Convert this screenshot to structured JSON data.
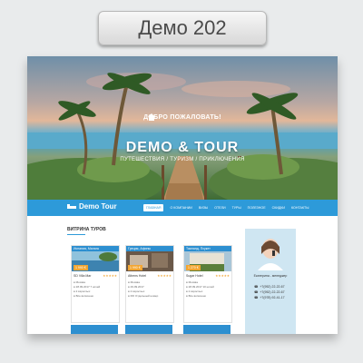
{
  "badge": {
    "label": "Демо 202"
  },
  "hero": {
    "welcome": "ДОБРО ПОЖАЛОВАТЬ!",
    "brand": "DEMO & TOUR",
    "tagline": "ПУТЕШЕСТВИЯ / ТУРИЗМ / ПРИКЛЮЧЕНИЯ"
  },
  "nav": {
    "logo": "Demo Tour",
    "items": [
      "ГЛАВНАЯ",
      "О КОМПАНИИ",
      "ВИЗЫ",
      "ОТЕЛИ",
      "ТУРЫ",
      "ПОЛЕЗНОЕ",
      "СКИДКИ",
      "КОНТАКТЫ"
    ]
  },
  "section": {
    "title": "ВИТРИНА ТУРОВ"
  },
  "cards": [
    {
      "title": "Испания, Малага",
      "price": "1 990 €",
      "name": "SD Villa Mar",
      "stars": "★★★★★",
      "lines": [
        "● Москва",
        "● 28.09.2017 7 ночей",
        "● 2 взрослых",
        "● Все включено"
      ]
    },
    {
      "title": "Греция, Афины",
      "price": "1 990 €",
      "name": "Athens Hotel",
      "stars": "★★★★★",
      "lines": [
        "● Москва",
        "● 29.09.2017",
        "● 2 взрослых",
        "● RO Отдельный номер"
      ]
    },
    {
      "title": "Таиланд, Пхукет",
      "price": "1 270 €",
      "name": "Sugar Hotel",
      "stars": "★★★★★",
      "lines": [
        "● Москва",
        "● 28.09.2017 10 ночей",
        "● 2 взрослых",
        "● Все включено"
      ]
    }
  ],
  "agent": {
    "name": "Екатерина - менеджер",
    "phones": [
      "+7(952) 22-22-67",
      "+7(952) 22-22-67",
      "+7(978) 92-41-17"
    ]
  },
  "colors": {
    "accent": "#2d9ad9",
    "price": "#f2a531",
    "sidebar": "#cfe6f2"
  }
}
